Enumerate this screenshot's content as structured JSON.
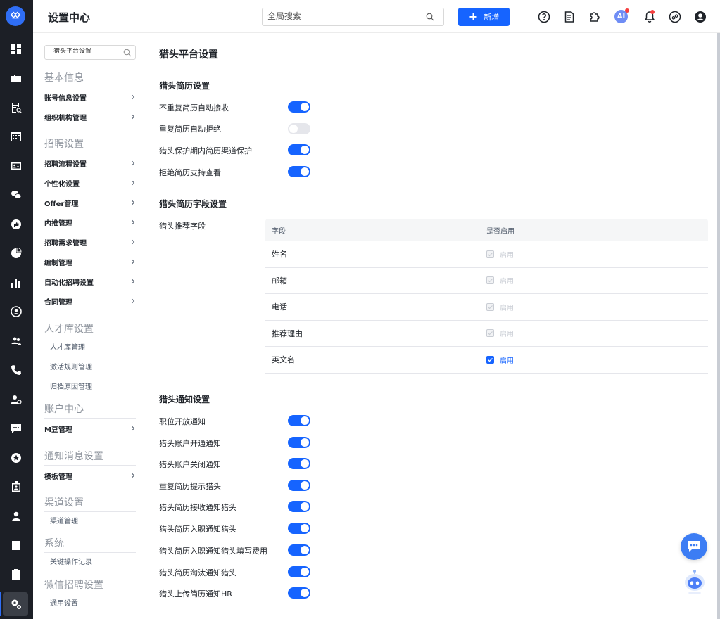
{
  "header": {
    "title": "设置中心",
    "search_placeholder": "全局搜索",
    "new_button_label": "新增",
    "ai_label": "AI"
  },
  "sidebar": {
    "search_placeholder": "猎头平台设置",
    "sections": {
      "basic": "基本信息",
      "recruit": "招聘设置",
      "talent": "人才库设置",
      "account": "账户中心",
      "notify": "通知消息设置",
      "channel": "渠道设置",
      "system": "系统",
      "wechat": "微信招聘设置"
    },
    "items": {
      "account_info": "账号信息设置",
      "org": "组织机构管理",
      "process": "招聘流程设置",
      "personal": "个性化设置",
      "offer": "Offer管理",
      "referral": "内推管理",
      "demand": "招聘需求管理",
      "headcount": "编制管理",
      "auto": "自动化招聘设置",
      "contract": "合同管理",
      "talent_mgmt": "人才库管理",
      "activation": "激活规则管理",
      "archive": "归档原因管理",
      "mbean": "M豆管理",
      "template": "模板管理",
      "channel_mgmt": "渠道管理",
      "oplog": "关键操作记录",
      "general": "通用设置"
    }
  },
  "main": {
    "title": "猎头平台设置",
    "resume_section": {
      "title": "猎头简历设置",
      "rows": [
        {
          "label": "不重复简历自动接收",
          "on": true
        },
        {
          "label": "重复简历自动拒绝",
          "on": false
        },
        {
          "label": "猎头保护期内简历渠道保护",
          "on": true
        },
        {
          "label": "拒绝简历支持查看",
          "on": true
        }
      ]
    },
    "field_section": {
      "title": "猎头简历字段设置",
      "label": "猎头推荐字段",
      "columns": [
        "字段",
        "是否启用"
      ],
      "rows": [
        {
          "field": "姓名",
          "status": "启用",
          "checked": true,
          "editable": false
        },
        {
          "field": "邮箱",
          "status": "启用",
          "checked": true,
          "editable": false
        },
        {
          "field": "电话",
          "status": "启用",
          "checked": true,
          "editable": false
        },
        {
          "field": "推荐理由",
          "status": "启用",
          "checked": true,
          "editable": false
        },
        {
          "field": "英文名",
          "status": "启用",
          "checked": true,
          "editable": true
        }
      ]
    },
    "notify_section": {
      "title": "猎头通知设置",
      "rows": [
        {
          "label": "职位开放通知",
          "on": true
        },
        {
          "label": "猎头账户开通通知",
          "on": true
        },
        {
          "label": "猎头账户关闭通知",
          "on": true
        },
        {
          "label": "重复简历提示猎头",
          "on": true
        },
        {
          "label": "猎头简历接收通知猎头",
          "on": true
        },
        {
          "label": "猎头简历入职通知猎头",
          "on": true
        },
        {
          "label": "猎头简历入职通知猎头填写费用",
          "on": true
        },
        {
          "label": "猎头简历淘汰通知猎头",
          "on": true
        },
        {
          "label": "猎头上传简历通知HR",
          "on": true
        }
      ]
    }
  },
  "colors": {
    "accent": "#1664ff",
    "rail": "#1c1f26",
    "notification_dot": "#f53f3f"
  }
}
